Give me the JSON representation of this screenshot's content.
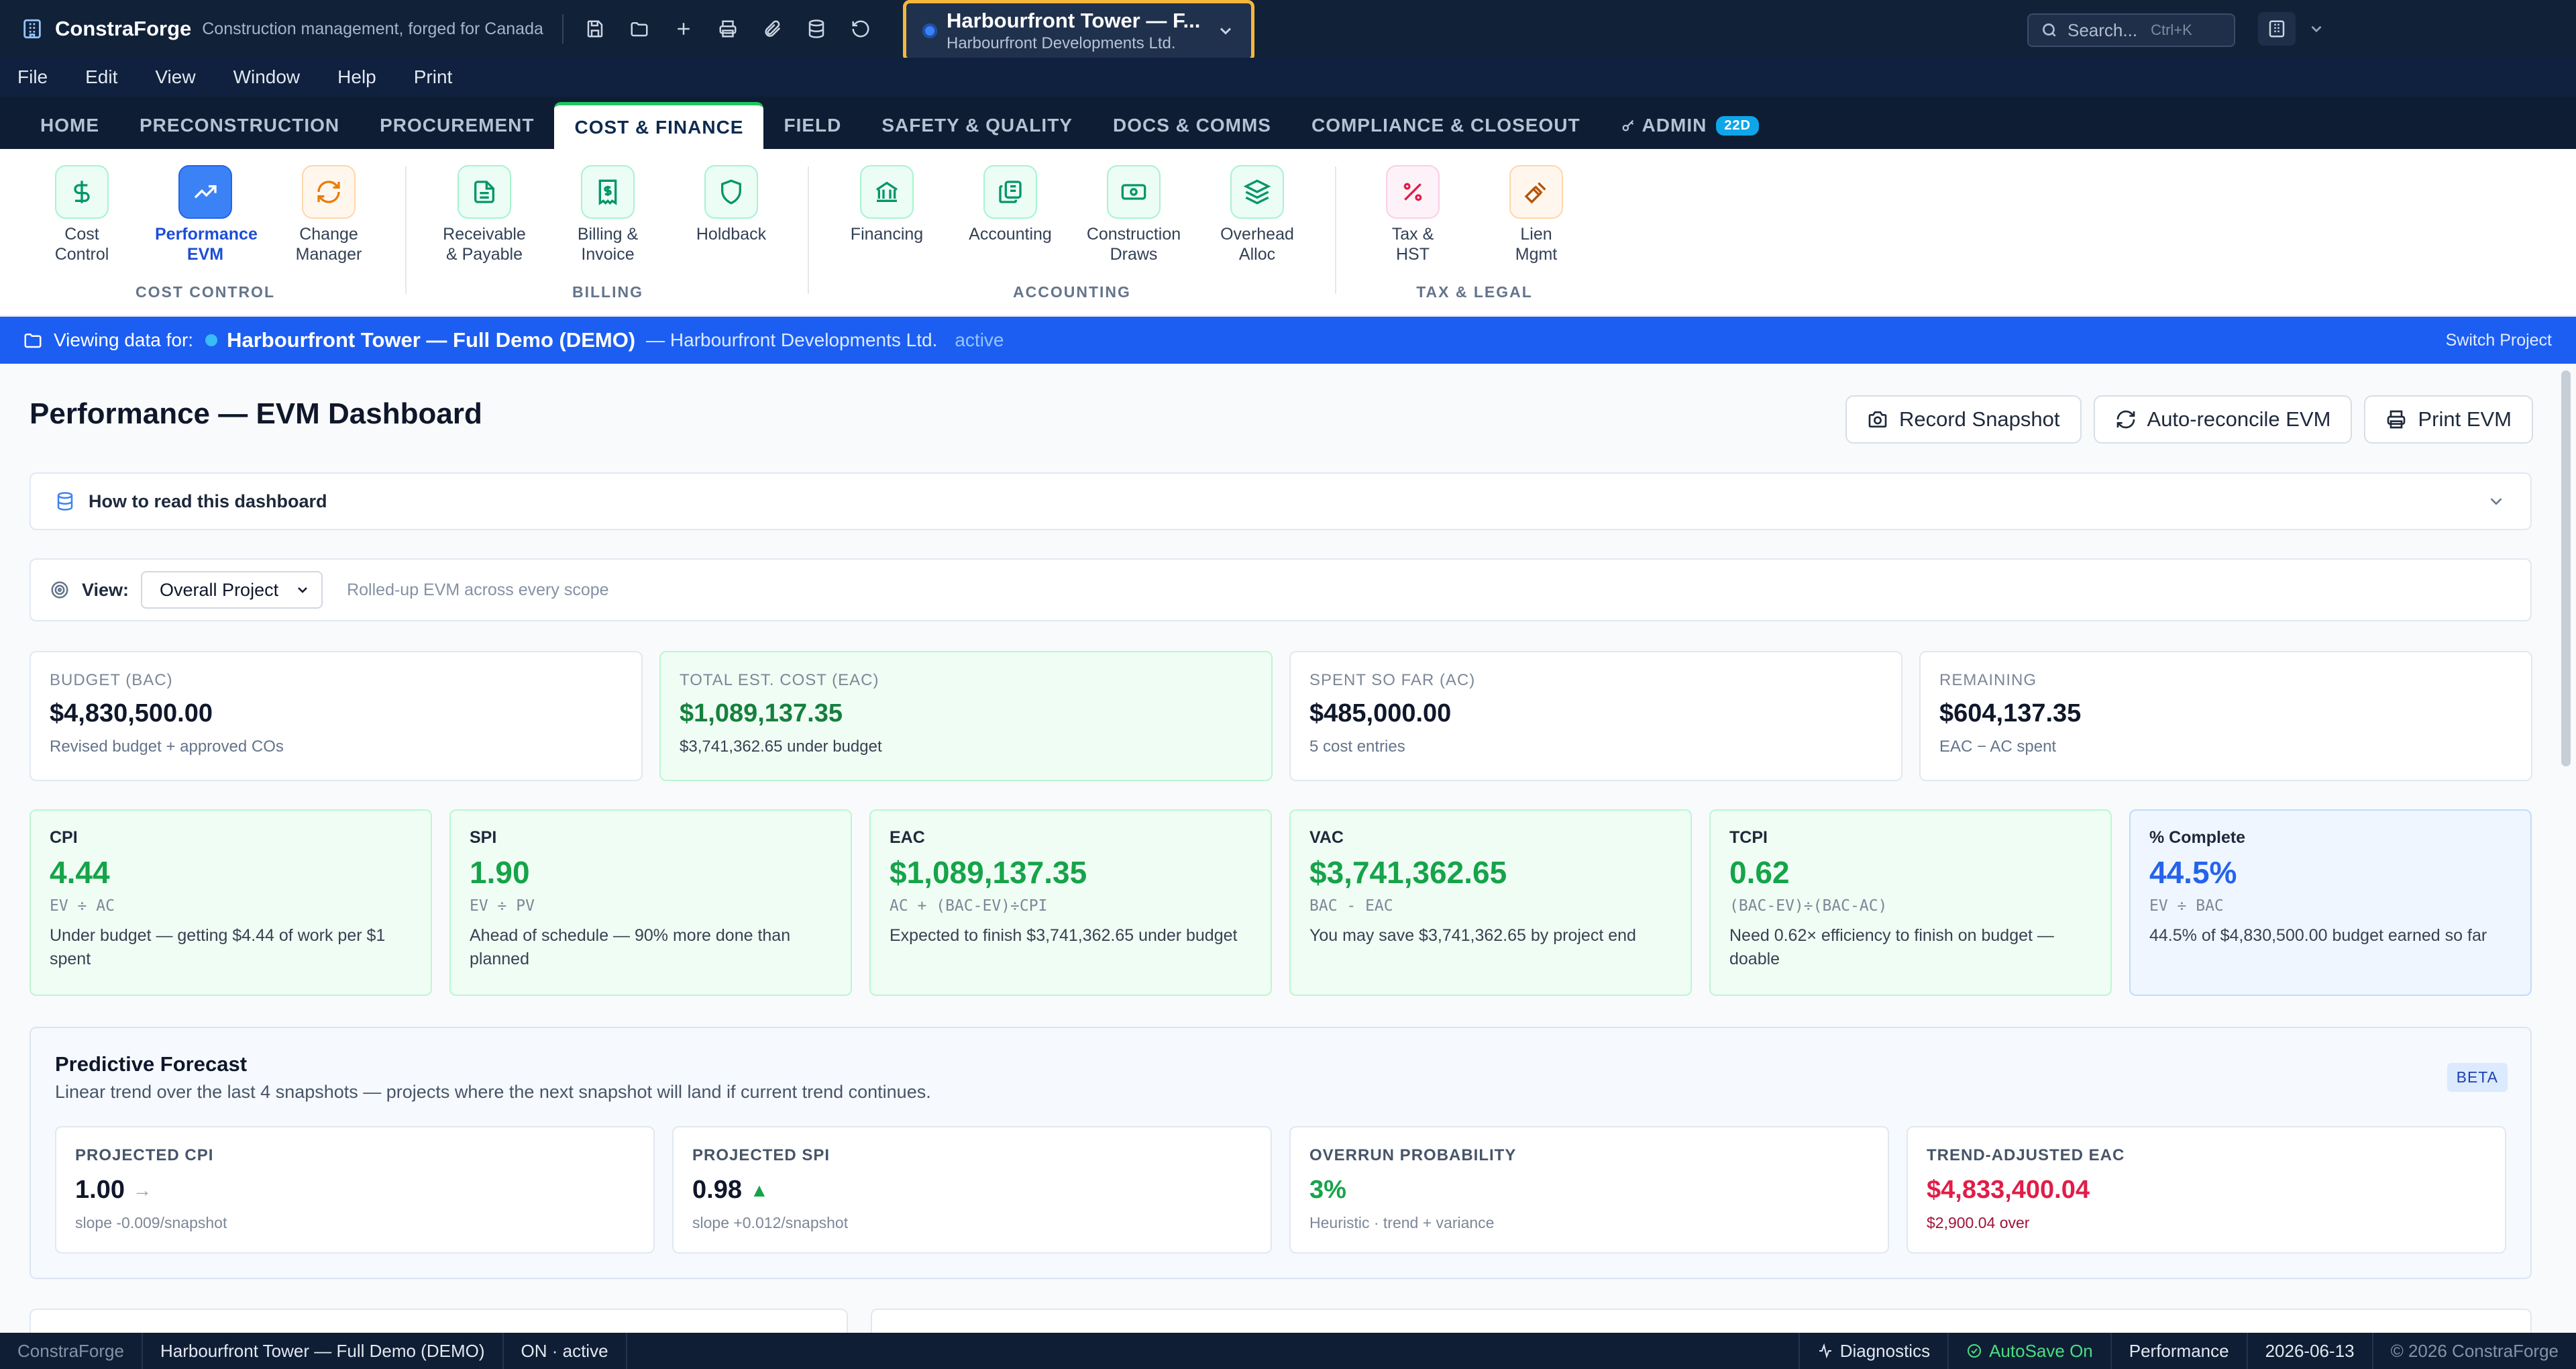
{
  "app": {
    "name": "ConstraForge",
    "tagline": "Construction management, forged for Canada"
  },
  "project_selector": {
    "title": "Harbourfront Tower — F...",
    "subtitle": "Harbourfront Developments Ltd."
  },
  "search": {
    "placeholder": "Search...",
    "shortcut": "Ctrl+K"
  },
  "menu": [
    "File",
    "Edit",
    "View",
    "Window",
    "Help",
    "Print"
  ],
  "tabs": [
    {
      "label": "HOME"
    },
    {
      "label": "PRECONSTRUCTION"
    },
    {
      "label": "PROCUREMENT"
    },
    {
      "label": "COST & FINANCE",
      "active": true
    },
    {
      "label": "FIELD"
    },
    {
      "label": "SAFETY & QUALITY"
    },
    {
      "label": "DOCS & COMMS"
    },
    {
      "label": "COMPLIANCE & CLOSEOUT"
    },
    {
      "label": "ADMIN",
      "badge": "22D"
    }
  ],
  "ribbon": {
    "groups": [
      "COST CONTROL",
      "BILLING",
      "ACCOUNTING",
      "TAX & LEGAL"
    ],
    "items": [
      {
        "label": "Cost Control",
        "icon": "dollar-icon"
      },
      {
        "label": "Performance EVM",
        "icon": "trending-up-icon",
        "selected": true
      },
      {
        "label": "Change Manager",
        "icon": "refresh-icon"
      },
      {
        "label": "Receivable & Payable",
        "icon": "document-icon"
      },
      {
        "label": "Billing & Invoice",
        "icon": "receipt-icon"
      },
      {
        "label": "Holdback",
        "icon": "shield-icon"
      },
      {
        "label": "Financing",
        "icon": "bank-icon"
      },
      {
        "label": "Accounting",
        "icon": "ledger-icon"
      },
      {
        "label": "Construction Draws",
        "icon": "banknote-icon"
      },
      {
        "label": "Overhead Alloc",
        "icon": "layers-icon"
      },
      {
        "label": "Tax & HST",
        "icon": "percent-icon"
      },
      {
        "label": "Lien Mgmt",
        "icon": "gavel-icon"
      }
    ]
  },
  "banner": {
    "prefix": "Viewing data for:",
    "project": "Harbourfront Tower — Full Demo (DEMO)",
    "developer": "— Harbourfront Developments Ltd.",
    "status": "active",
    "switch": "Switch Project"
  },
  "page": {
    "title": "Performance — EVM Dashboard",
    "actions": [
      "Record Snapshot",
      "Auto-reconcile EVM",
      "Print EVM"
    ],
    "howto": "How to read this dashboard",
    "view_label": "View:",
    "view_value": "Overall Project",
    "view_hint": "Rolled-up EVM across every scope"
  },
  "summary": [
    {
      "label": "BUDGET (BAC)",
      "value": "$4,830,500.00",
      "sub": "Revised budget + approved COs"
    },
    {
      "label": "TOTAL EST. COST (EAC)",
      "value": "$1,089,137.35",
      "sub": "$3,741,362.65 under budget",
      "highlight": true
    },
    {
      "label": "SPENT SO FAR (AC)",
      "value": "$485,000.00",
      "sub": "5 cost entries"
    },
    {
      "label": "REMAINING",
      "value": "$604,137.35",
      "sub": "EAC − AC spent"
    }
  ],
  "metrics": [
    {
      "label": "CPI",
      "value": "4.44",
      "formula": "EV ÷ AC",
      "desc": "Under budget — getting $4.44 of work per $1 spent"
    },
    {
      "label": "SPI",
      "value": "1.90",
      "formula": "EV ÷ PV",
      "desc": "Ahead of schedule — 90% more done than planned"
    },
    {
      "label": "EAC",
      "value": "$1,089,137.35",
      "formula": "AC + (BAC-EV)÷CPI",
      "desc": "Expected to finish $3,741,362.65 under budget"
    },
    {
      "label": "VAC",
      "value": "$3,741,362.65",
      "formula": "BAC - EAC",
      "desc": "You may save $3,741,362.65 by project end"
    },
    {
      "label": "TCPI",
      "value": "0.62",
      "formula": "(BAC-EV)÷(BAC-AC)",
      "desc": "Need 0.62× efficiency to finish on budget — doable"
    },
    {
      "label": "% Complete",
      "value": "44.5%",
      "formula": "EV ÷ BAC",
      "desc": "44.5% of $4,830,500.00 budget earned so far",
      "accent": "blue"
    }
  ],
  "forecast": {
    "title": "Predictive Forecast",
    "subtitle": "Linear trend over the last 4 snapshots — projects where the next snapshot will land if current trend continues.",
    "badge": "BETA",
    "cards": [
      {
        "label": "PROJECTED CPI",
        "value": "1.00",
        "trend": "→",
        "sub": "slope -0.009/snapshot"
      },
      {
        "label": "PROJECTED SPI",
        "value": "0.98",
        "trend": "▲",
        "sub": "slope +0.012/snapshot"
      },
      {
        "label": "OVERRUN PROBABILITY",
        "value": "3%",
        "sub": "Heuristic · trend + variance"
      },
      {
        "label": "TREND-ADJUSTED EAC",
        "value": "$4,833,400.04",
        "sub": "$2,900.04 over"
      }
    ]
  },
  "statusbar": {
    "app": "ConstraForge",
    "project": "Harbourfront Tower — Full Demo (DEMO)",
    "state": "ON · active",
    "diagnostics": "Diagnostics",
    "autosave": "AutoSave On",
    "module": "Performance",
    "date": "2026-06-13",
    "copyright": "© 2026 ConstraForge"
  },
  "colors": {
    "titlebar": "#112138",
    "banner": "#1d5ef2",
    "positive": "#16a34a",
    "negative": "#e11d48",
    "accent_blue": "#2563eb",
    "selector_border": "#f5b73b"
  }
}
